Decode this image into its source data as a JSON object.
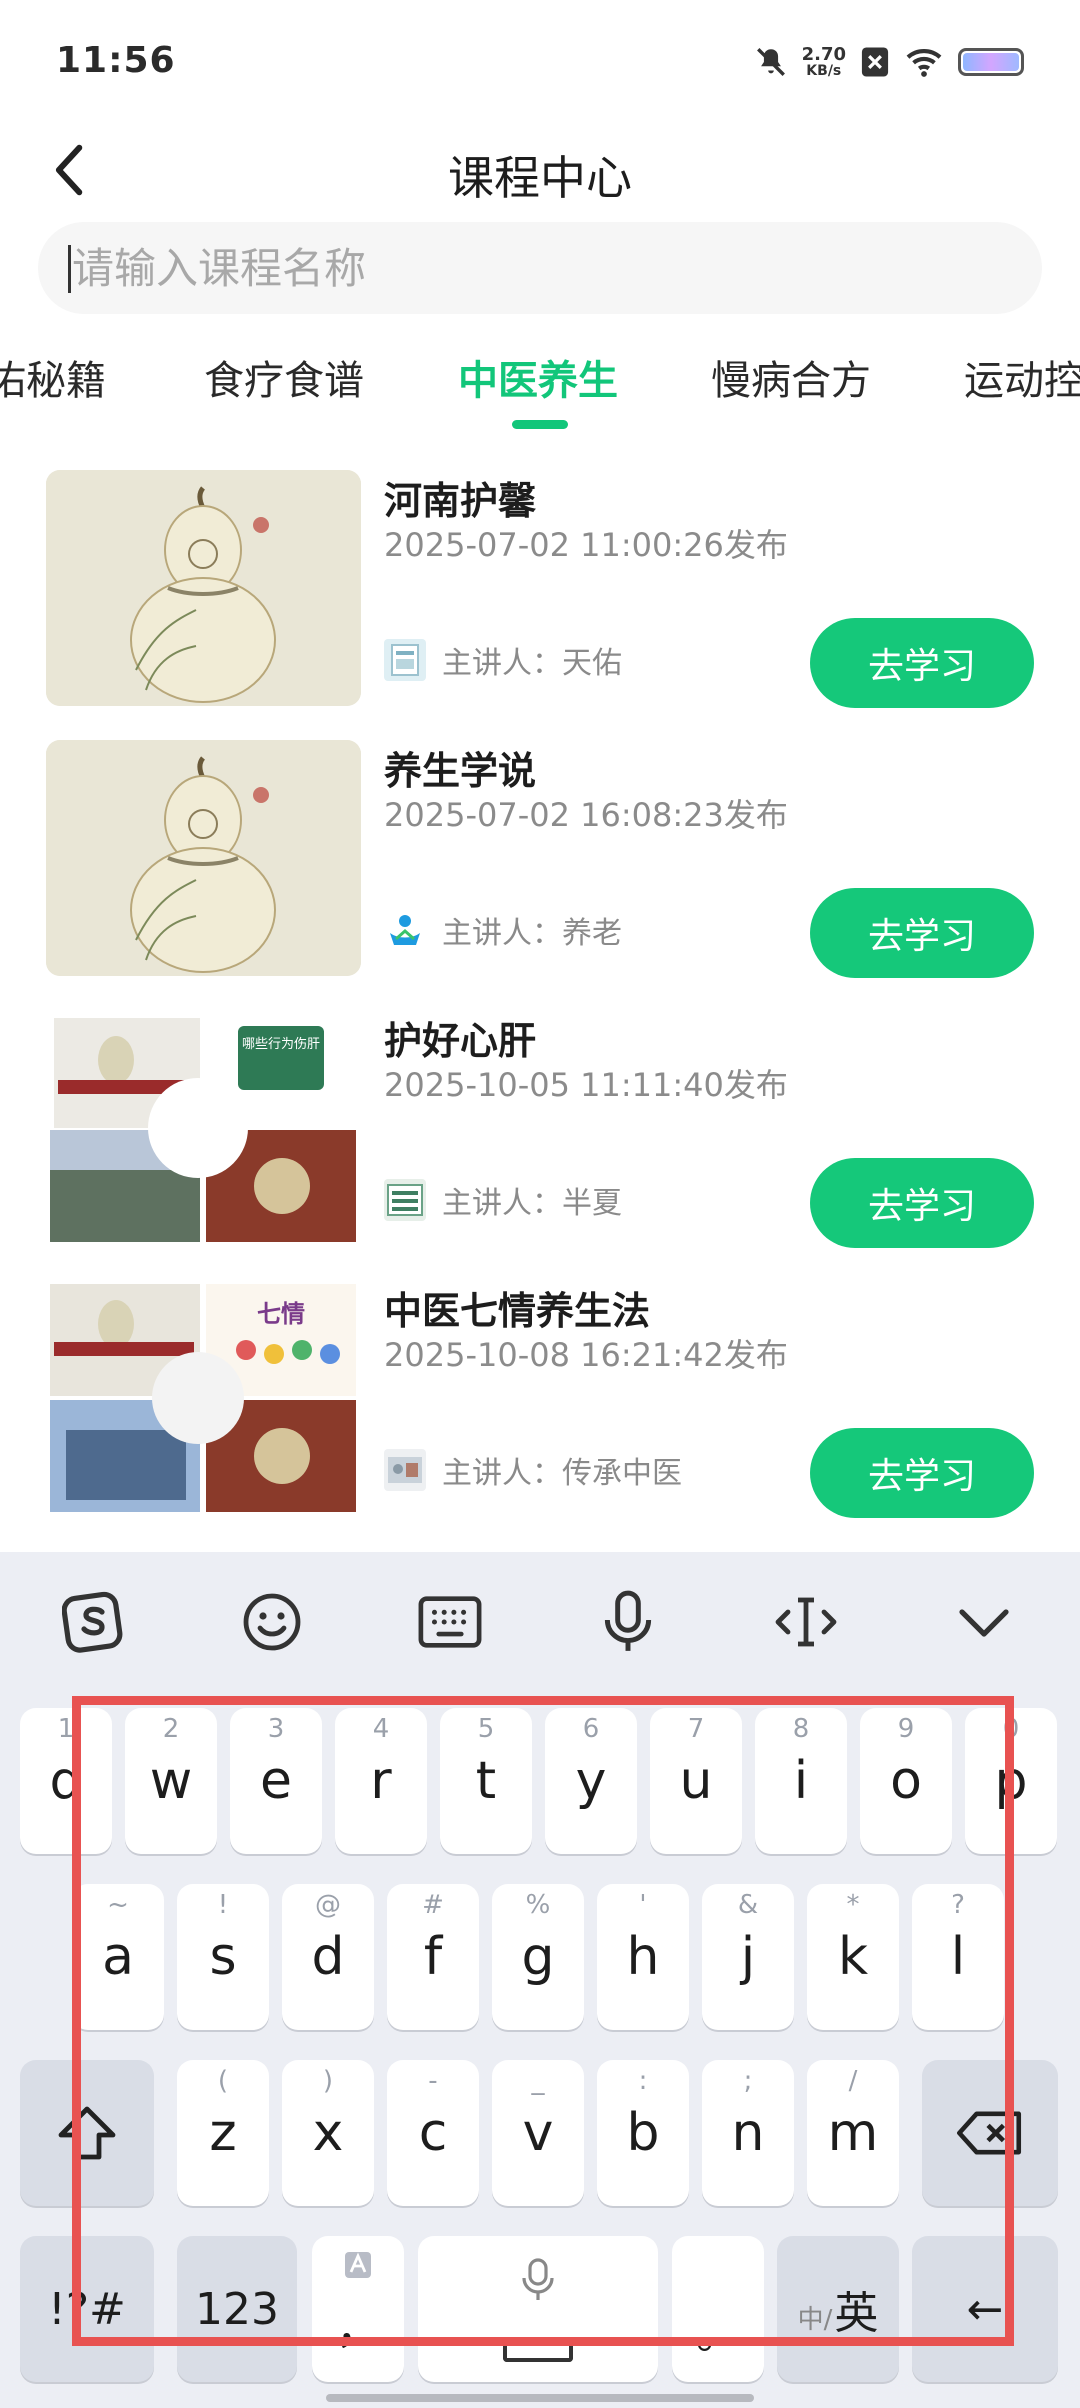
{
  "status_bar": {
    "time": "11:56",
    "net_speed": "2.70",
    "net_unit": "KB/s"
  },
  "header": {
    "title": "课程中心"
  },
  "search": {
    "placeholder": "请输入课程名称",
    "value": ""
  },
  "tabs": [
    {
      "label": "佑秘籍"
    },
    {
      "label": "食疗食谱"
    },
    {
      "label": "中医养生",
      "active": true
    },
    {
      "label": "慢病合方"
    },
    {
      "label": "运动控"
    }
  ],
  "courses": [
    {
      "title": "河南护馨",
      "date": "2025-07-02 11:00:26发布",
      "lecturer": "主讲人：天佑",
      "button": "去学习",
      "thumb": "gourd-illustration"
    },
    {
      "title": "养生学说",
      "date": "2025-07-02 16:08:23发布",
      "lecturer": "主讲人：养老",
      "button": "去学习",
      "thumb": "gourd-illustration"
    },
    {
      "title": "护好心肝",
      "date": "2025-10-05 11:11:40发布",
      "lecturer": "主讲人：半夏",
      "button": "去学习",
      "thumb": "photo-collage",
      "thumb_caption": "哪些行为伤肝"
    },
    {
      "title": "中医七情养生法",
      "date": "2025-10-08 16:21:42发布",
      "lecturer": "主讲人：传承中医",
      "button": "去学习",
      "thumb": "photo-collage",
      "thumb_caption": "七情"
    }
  ],
  "keyboard": {
    "row1": [
      {
        "k": "q",
        "s": "1"
      },
      {
        "k": "w",
        "s": "2"
      },
      {
        "k": "e",
        "s": "3"
      },
      {
        "k": "r",
        "s": "4"
      },
      {
        "k": "t",
        "s": "5"
      },
      {
        "k": "y",
        "s": "6"
      },
      {
        "k": "u",
        "s": "7"
      },
      {
        "k": "i",
        "s": "8"
      },
      {
        "k": "o",
        "s": "9"
      },
      {
        "k": "p",
        "s": "0"
      }
    ],
    "row2": [
      {
        "k": "a",
        "s": "~"
      },
      {
        "k": "s",
        "s": "!"
      },
      {
        "k": "d",
        "s": "@"
      },
      {
        "k": "f",
        "s": "#"
      },
      {
        "k": "g",
        "s": "%"
      },
      {
        "k": "h",
        "s": "'"
      },
      {
        "k": "j",
        "s": "&"
      },
      {
        "k": "k",
        "s": "*"
      },
      {
        "k": "l",
        "s": "?"
      }
    ],
    "row3": [
      {
        "k": "z",
        "s": "("
      },
      {
        "k": "x",
        "s": ")"
      },
      {
        "k": "c",
        "s": "-"
      },
      {
        "k": "v",
        "s": "_"
      },
      {
        "k": "b",
        "s": ":"
      },
      {
        "k": "n",
        "s": ";"
      },
      {
        "k": "m",
        "s": "/"
      }
    ],
    "symbols_key": "!?#",
    "numbers_key": "123",
    "comma_key": "，",
    "period_key": "。",
    "lang_zh": "中/",
    "lang_en": "英",
    "enter_key": "←"
  },
  "colors": {
    "accent": "#12c67a",
    "button": "#15c87a",
    "highlight": "#e85251"
  }
}
